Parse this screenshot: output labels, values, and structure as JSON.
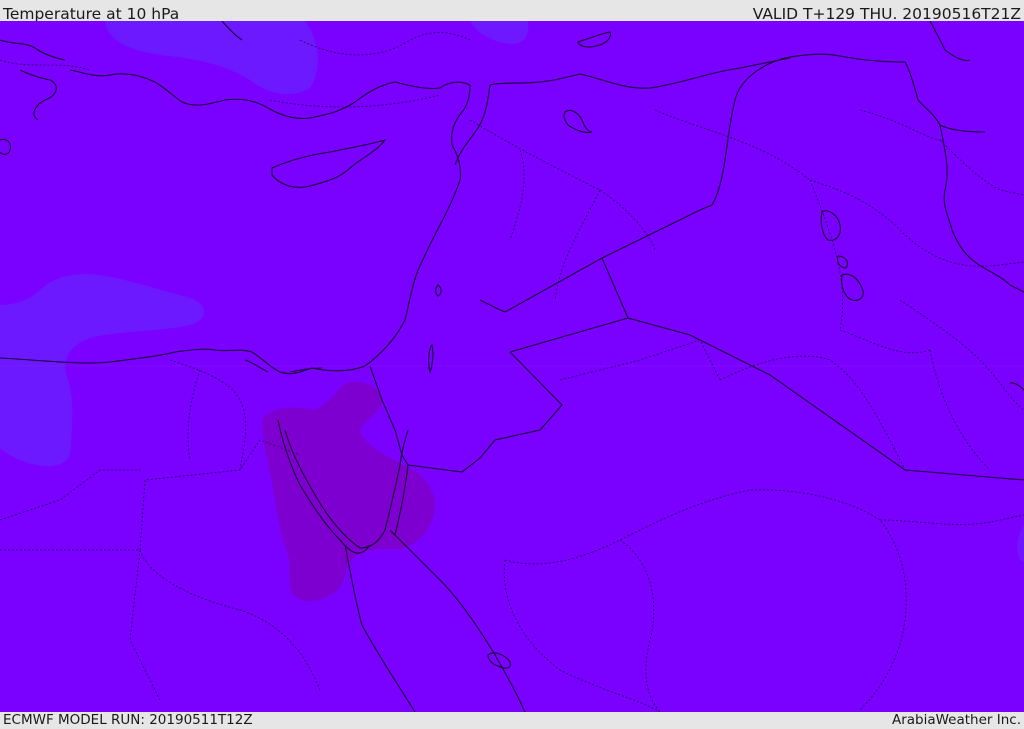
{
  "header": {
    "title": "Temperature at 10 hPa",
    "valid_time": "VALID T+129 THU. 20190516T21Z"
  },
  "footer": {
    "model_run": "ECMWF MODEL RUN: 20190511T12Z",
    "credit": "ArabiaWeather Inc."
  },
  "colors": {
    "field_base": "#7a00ff",
    "field_cooler": "#6a22ff",
    "field_warmer": "#7d00cc",
    "outline": "#1a0033"
  }
}
